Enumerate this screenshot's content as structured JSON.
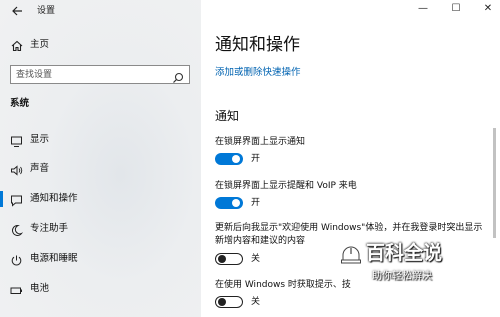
{
  "window": {
    "title": "设置",
    "minimize": "—",
    "maximize": "☐",
    "close": "✕"
  },
  "sidebar": {
    "home_label": "主页",
    "search_placeholder": "查找设置",
    "section_title": "系统",
    "items": [
      {
        "label": "显示",
        "icon": "monitor-icon"
      },
      {
        "label": "声音",
        "icon": "speaker-icon"
      },
      {
        "label": "通知和操作",
        "icon": "notification-icon",
        "active": true
      },
      {
        "label": "专注助手",
        "icon": "moon-icon"
      },
      {
        "label": "电源和睡眠",
        "icon": "power-icon"
      },
      {
        "label": "电池",
        "icon": "battery-icon"
      }
    ]
  },
  "main": {
    "title": "通知和操作",
    "link": "添加或删除快速操作",
    "section": "通知",
    "options": [
      {
        "label": "在锁屏界面上显示通知",
        "state": "开",
        "on": true
      },
      {
        "label": "在锁屏界面上显示提醒和 VoIP 来电",
        "state": "开",
        "on": true
      },
      {
        "label": "更新后向我显示\"欢迎使用 Windows\"体验，并在我登录时突出显示新增内容和建议的内容",
        "state": "关",
        "on": false
      },
      {
        "label": "在使用 Windows 时获取提示、技",
        "state": "关",
        "on": false
      }
    ]
  },
  "watermark": {
    "title": "百科全说",
    "subtitle": "助你轻松解决"
  },
  "colors": {
    "accent": "#0078d7",
    "link": "#0063b1"
  }
}
